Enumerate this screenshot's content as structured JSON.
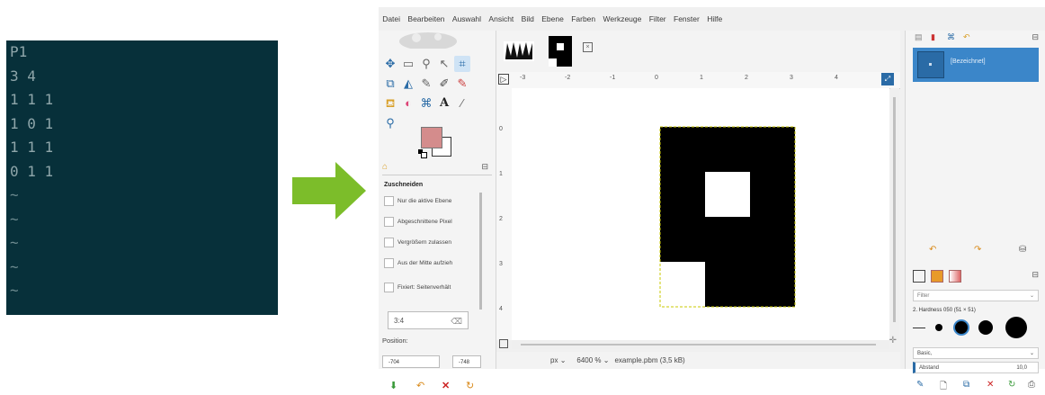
{
  "terminal": {
    "lines": [
      "P1",
      "3 4",
      "1 1 1",
      "1 0 1",
      "1 1 1",
      "0 1 1",
      "~",
      "~",
      "~",
      "~",
      "~"
    ]
  },
  "arrow": {
    "color": "#7cbd2a"
  },
  "gimp": {
    "menu": [
      "Datei",
      "Bearbeiten",
      "Auswahl",
      "Ansicht",
      "Bild",
      "Ebene",
      "Farben",
      "Werkzeuge",
      "Filter",
      "Fenster",
      "Hilfe"
    ],
    "tool_options": {
      "title": "Zuschneiden",
      "options": [
        "Nur die aktive Ebene",
        "Abgeschnittene Pixel",
        "Vergrößern zulassen",
        "Aus der Mitte aufzieh",
        "Fixiert: Seitenverhält"
      ],
      "ratio": "3:4",
      "position_label": "Position:",
      "position_x": "-704",
      "position_y": "-748"
    },
    "ruler_ticks": [
      "-3",
      "-2",
      "-1",
      "0",
      "1",
      "2",
      "3",
      "4"
    ],
    "ruler_vticks": [
      "0",
      "1",
      "2",
      "3",
      "4"
    ],
    "status": {
      "unit": "px",
      "zoom": "6400 %",
      "file": "example.pbm (3,5 kB)"
    },
    "layers": {
      "layer_name": "[Bezeichnet]"
    },
    "brushes": {
      "filter_placeholder": "Filter",
      "brush_name": "2. Hardness 050 (51 × 51)",
      "preset": "Basic,",
      "spacing_label": "Abstand",
      "spacing_value": "10,0"
    },
    "colors": {
      "fg": "#d48c8c",
      "bg": "#ffffff",
      "selection": "#3b86c9"
    }
  }
}
